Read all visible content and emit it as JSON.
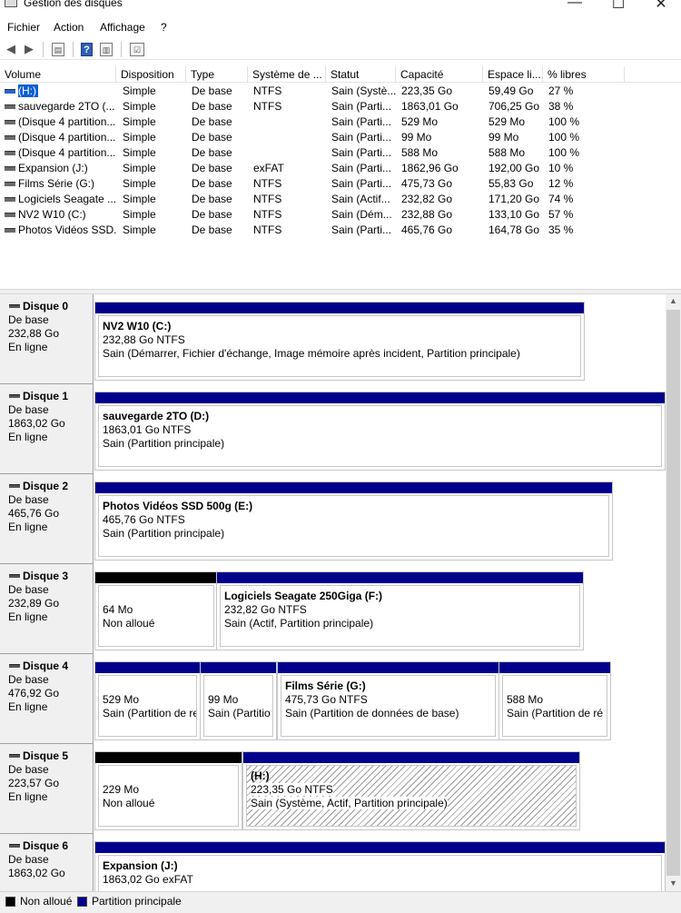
{
  "window": {
    "title": "Gestion des disques",
    "minimize_glyph": "—",
    "maximize_glyph": "☐",
    "close_glyph": "✕"
  },
  "menu": [
    "Fichier",
    "Action",
    "Affichage",
    "?"
  ],
  "toolbar": {
    "back_icon": "arrow-left",
    "forward_icon": "arrow-right",
    "help_glyph": "?"
  },
  "volume_list": {
    "columns": [
      "Volume",
      "Disposition",
      "Type",
      "Système de ...",
      "Statut",
      "Capacité",
      "Espace li...",
      "% libres"
    ],
    "rows": [
      {
        "volume": "(H:)",
        "disposition": "Simple",
        "type": "De base",
        "fs": "NTFS",
        "status": "Sain (Systè...",
        "capacity": "223,35 Go",
        "free": "59,49 Go",
        "pct": "27 %",
        "selected": true
      },
      {
        "volume": "sauvegarde 2TO (...",
        "disposition": "Simple",
        "type": "De base",
        "fs": "NTFS",
        "status": "Sain (Parti...",
        "capacity": "1863,01 Go",
        "free": "706,25 Go",
        "pct": "38 %"
      },
      {
        "volume": "(Disque 4 partition...",
        "disposition": "Simple",
        "type": "De base",
        "fs": "",
        "status": "Sain (Parti...",
        "capacity": "529 Mo",
        "free": "529 Mo",
        "pct": "100 %"
      },
      {
        "volume": "(Disque 4 partition...",
        "disposition": "Simple",
        "type": "De base",
        "fs": "",
        "status": "Sain (Parti...",
        "capacity": "99 Mo",
        "free": "99 Mo",
        "pct": "100 %"
      },
      {
        "volume": "(Disque 4 partition...",
        "disposition": "Simple",
        "type": "De base",
        "fs": "",
        "status": "Sain (Parti...",
        "capacity": "588 Mo",
        "free": "588 Mo",
        "pct": "100 %"
      },
      {
        "volume": "Expansion (J:)",
        "disposition": "Simple",
        "type": "De base",
        "fs": "exFAT",
        "status": "Sain (Parti...",
        "capacity": "1862,96 Go",
        "free": "192,00 Go",
        "pct": "10 %"
      },
      {
        "volume": "Films Série (G:)",
        "disposition": "Simple",
        "type": "De base",
        "fs": "NTFS",
        "status": "Sain (Parti...",
        "capacity": "475,73 Go",
        "free": "55,83 Go",
        "pct": "12 %"
      },
      {
        "volume": "Logiciels Seagate ...",
        "disposition": "Simple",
        "type": "De base",
        "fs": "NTFS",
        "status": "Sain (Actif...",
        "capacity": "232,82 Go",
        "free": "171,20 Go",
        "pct": "74 %"
      },
      {
        "volume": "NV2 W10 (C:)",
        "disposition": "Simple",
        "type": "De base",
        "fs": "NTFS",
        "status": "Sain (Dém...",
        "capacity": "232,88 Go",
        "free": "133,10 Go",
        "pct": "57 %"
      },
      {
        "volume": "Photos Vidéos SSD...",
        "disposition": "Simple",
        "type": "De base",
        "fs": "NTFS",
        "status": "Sain (Parti...",
        "capacity": "465,76 Go",
        "free": "164,78 Go",
        "pct": "35 %"
      }
    ]
  },
  "disks": [
    {
      "name": "Disque 0",
      "kind": "De base",
      "size": "232,88 Go",
      "state": "En ligne",
      "partitions": [
        {
          "title": "NV2 W10  (C:)",
          "size": "232,88 Go NTFS",
          "status": "Sain (Démarrer, Fichier d'échange, Image mémoire après incident, Partition principale)",
          "alloc": "primary"
        }
      ]
    },
    {
      "name": "Disque 1",
      "kind": "De base",
      "size": "1863,02 Go",
      "state": "En ligne",
      "partitions": [
        {
          "title": "sauvegarde 2TO  (D:)",
          "size": "1863,01 Go NTFS",
          "status": "Sain (Partition principale)",
          "alloc": "primary"
        }
      ]
    },
    {
      "name": "Disque 2",
      "kind": "De base",
      "size": "465,76 Go",
      "state": "En ligne",
      "partitions": [
        {
          "title": "Photos Vidéos SSD 500g  (E:)",
          "size": "465,76 Go NTFS",
          "status": "Sain (Partition principale)",
          "alloc": "primary"
        }
      ]
    },
    {
      "name": "Disque 3",
      "kind": "De base",
      "size": "232,89 Go",
      "state": "En ligne",
      "partitions": [
        {
          "title": "",
          "size": "64 Mo",
          "status": "Non alloué",
          "alloc": "unallocated"
        },
        {
          "title": "Logiciels Seagate 250Giga  (F:)",
          "size": "232,82 Go NTFS",
          "status": "Sain (Actif, Partition principale)",
          "alloc": "primary"
        }
      ]
    },
    {
      "name": "Disque 4",
      "kind": "De base",
      "size": "476,92 Go",
      "state": "En ligne",
      "partitions": [
        {
          "title": "",
          "size": "529 Mo",
          "status": "Sain (Partition de re",
          "alloc": "primary"
        },
        {
          "title": "",
          "size": "99 Mo",
          "status": "Sain (Partitio",
          "alloc": "primary"
        },
        {
          "title": "Films Série  (G:)",
          "size": "475,73 Go NTFS",
          "status": "Sain (Partition de données de base)",
          "alloc": "primary"
        },
        {
          "title": "",
          "size": "588 Mo",
          "status": "Sain (Partition de ré",
          "alloc": "primary"
        }
      ]
    },
    {
      "name": "Disque 5",
      "kind": "De base",
      "size": "223,57 Go",
      "state": "En ligne",
      "partitions": [
        {
          "title": "",
          "size": "229 Mo",
          "status": "Non alloué",
          "alloc": "unallocated"
        },
        {
          "title": "(H:)",
          "size": "223,35 Go NTFS",
          "status": "Sain (Système, Actif, Partition principale)",
          "alloc": "primary",
          "selected": true
        }
      ]
    },
    {
      "name": "Disque 6",
      "kind": "De base",
      "size": "1863,02 Go",
      "state": "",
      "partitions": [
        {
          "title": "Expansion  (J:)",
          "size": "1863,02 Go exFAT",
          "status": "",
          "alloc": "primary"
        }
      ]
    }
  ],
  "legend": {
    "unallocated": "Non alloué",
    "primary": "Partition principale",
    "colors": {
      "unallocated": "#000000",
      "primary": "#00008b"
    }
  }
}
